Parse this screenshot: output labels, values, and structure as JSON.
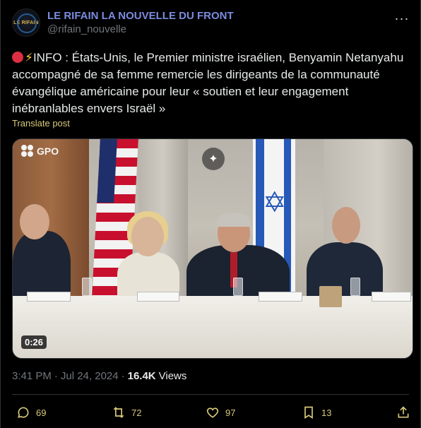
{
  "author": {
    "display_name": "LE RIFAIN LA NOUVELLE DU FRONT",
    "handle": "@rifain_nouvelle",
    "avatar_logo_text": "LE RIFAIN"
  },
  "post": {
    "text": "INFO : États-Unis, le Premier ministre israélien, Benyamin Netanyahu accompagné de sa femme remercie les dirigeants de la communauté évangélique américaine pour leur « soutien et leur engagement inébranlables envers Israël »",
    "translate_label": "Translate post"
  },
  "media": {
    "watermark": "GPO",
    "duration": "0:26"
  },
  "meta": {
    "time": "3:41 PM",
    "date": "Jul 24, 2024",
    "views_count": "16.4K",
    "views_label": "Views"
  },
  "actions": {
    "replies": "69",
    "reposts": "72",
    "likes": "97",
    "bookmarks": "13"
  },
  "colors": {
    "background": "#000000",
    "name_color": "#7b8cde",
    "accent": "#d8c97a",
    "muted": "#71767b"
  }
}
